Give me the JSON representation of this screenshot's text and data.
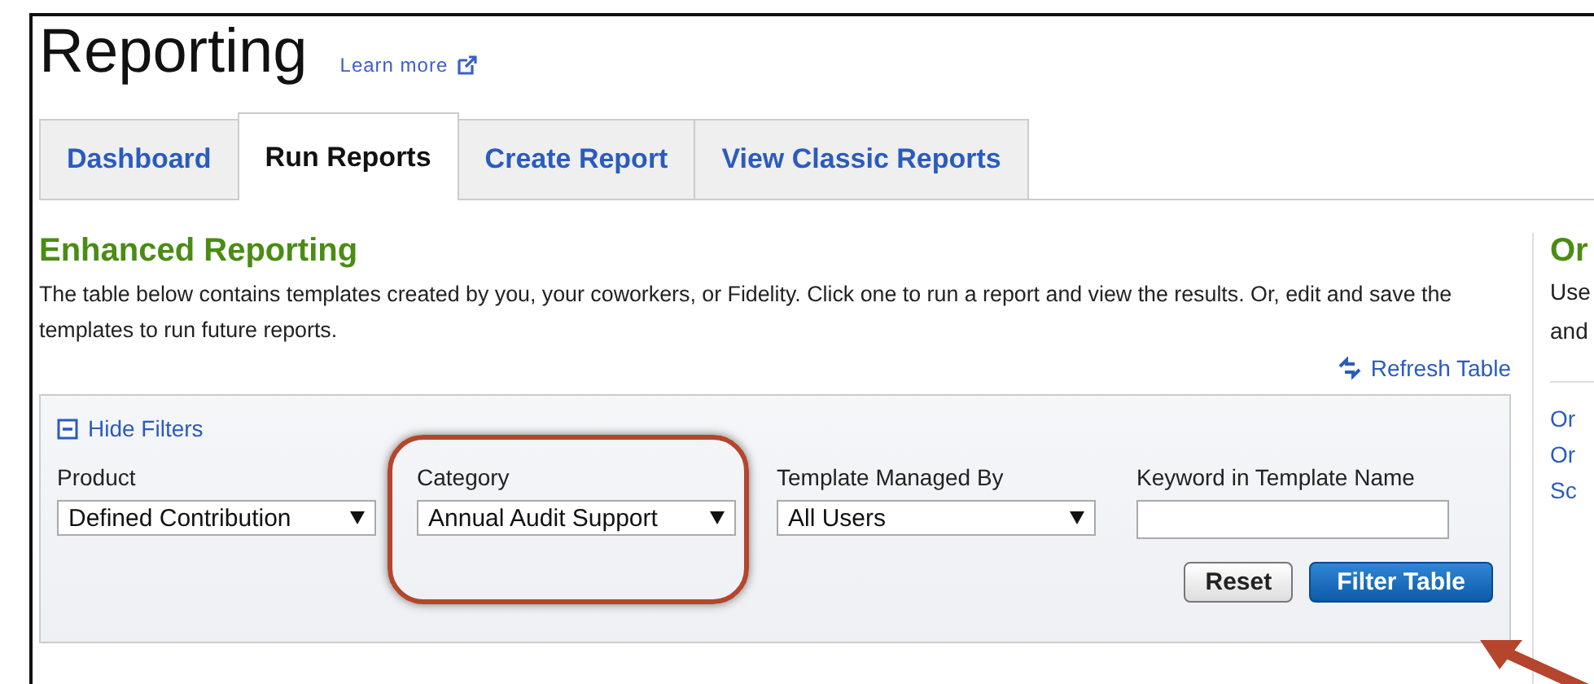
{
  "page": {
    "title": "Reporting",
    "learn_more": "Learn more"
  },
  "tabs": [
    {
      "label": "Dashboard",
      "selected": false
    },
    {
      "label": "Run Reports",
      "selected": true
    },
    {
      "label": "Create Report",
      "selected": false
    },
    {
      "label": "View Classic Reports",
      "selected": false
    }
  ],
  "section": {
    "heading": "Enhanced Reporting",
    "description": "The table below contains templates created by you, your coworkers, or Fidelity. Click one to run a report and view the results. Or, edit and save the templates to run future reports.",
    "refresh": "Refresh Table"
  },
  "filters": {
    "toggle": "Hide Filters",
    "expanded": true,
    "fields": [
      {
        "label": "Product",
        "kind": "select",
        "value": "Defined Contribution",
        "highlighted": false
      },
      {
        "label": "Category",
        "kind": "select",
        "value": "Annual Audit Support",
        "highlighted": true
      },
      {
        "label": "Template Managed By",
        "kind": "select",
        "value": "All Users",
        "highlighted": false
      },
      {
        "label": "Keyword in Template Name",
        "kind": "text",
        "highlighted": false
      }
    ],
    "buttons": [
      {
        "label": "Reset",
        "kind": "secondary"
      },
      {
        "label": "Filter Table",
        "kind": "primary"
      }
    ]
  },
  "side_panel": {
    "heading": "Or",
    "text_lines": [
      "Use",
      "and"
    ],
    "links": [
      "Or",
      "Or",
      "Sc"
    ]
  }
}
